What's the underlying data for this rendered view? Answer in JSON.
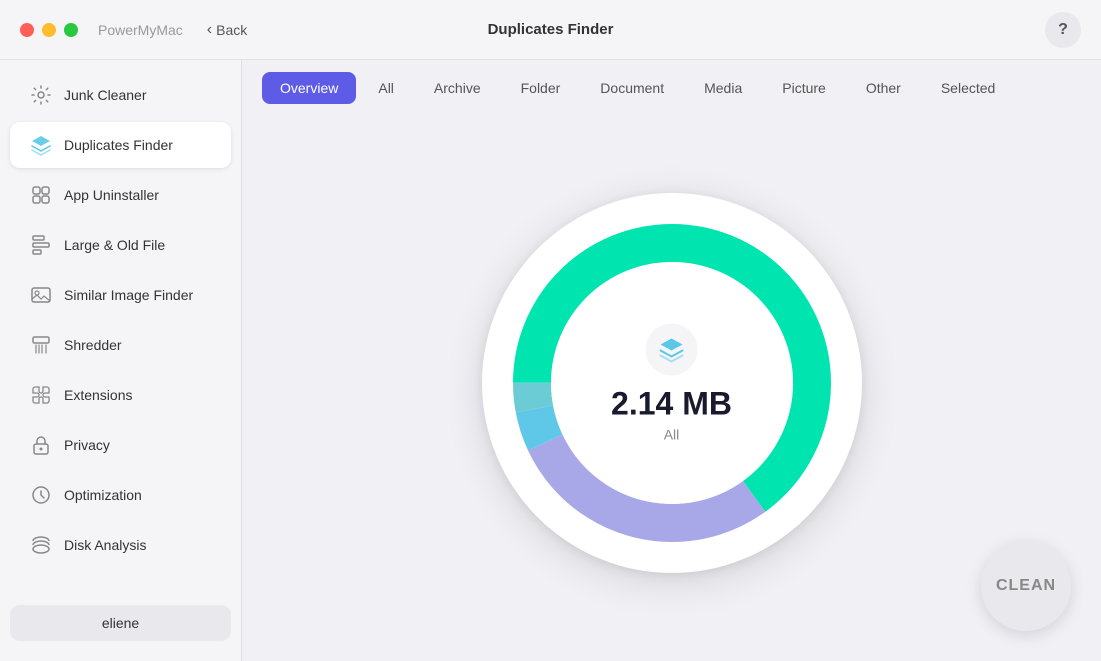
{
  "titlebar": {
    "app_name": "PowerMyMac",
    "back_label": "Back",
    "title": "Duplicates Finder",
    "help_label": "?"
  },
  "sidebar": {
    "items": [
      {
        "id": "junk-cleaner",
        "label": "Junk Cleaner",
        "icon": "gear"
      },
      {
        "id": "duplicates-finder",
        "label": "Duplicates Finder",
        "icon": "layers",
        "active": true
      },
      {
        "id": "app-uninstaller",
        "label": "App Uninstaller",
        "icon": "app"
      },
      {
        "id": "large-old-file",
        "label": "Large & Old File",
        "icon": "file"
      },
      {
        "id": "similar-image",
        "label": "Similar Image Finder",
        "icon": "image"
      },
      {
        "id": "shredder",
        "label": "Shredder",
        "icon": "shredder"
      },
      {
        "id": "extensions",
        "label": "Extensions",
        "icon": "extensions"
      },
      {
        "id": "privacy",
        "label": "Privacy",
        "icon": "lock"
      },
      {
        "id": "optimization",
        "label": "Optimization",
        "icon": "optimization"
      },
      {
        "id": "disk-analysis",
        "label": "Disk Analysis",
        "icon": "disk"
      }
    ],
    "user_label": "eliene"
  },
  "tabs": [
    {
      "id": "overview",
      "label": "Overview",
      "active": true
    },
    {
      "id": "all",
      "label": "All",
      "active": false
    },
    {
      "id": "archive",
      "label": "Archive",
      "active": false
    },
    {
      "id": "folder",
      "label": "Folder",
      "active": false
    },
    {
      "id": "document",
      "label": "Document",
      "active": false
    },
    {
      "id": "media",
      "label": "Media",
      "active": false
    },
    {
      "id": "picture",
      "label": "Picture",
      "active": false
    },
    {
      "id": "other",
      "label": "Other",
      "active": false
    },
    {
      "id": "selected",
      "label": "Selected",
      "active": false
    }
  ],
  "chart": {
    "size": "2.14 MB",
    "label": "All",
    "segments": [
      {
        "color": "#00e5b0",
        "value": 65
      },
      {
        "color": "#a8a8e8",
        "value": 28
      },
      {
        "color": "#5fc8e8",
        "value": 4
      },
      {
        "color": "#6bccd6",
        "value": 3
      }
    ]
  },
  "clean_button": {
    "label": "CLEAN"
  }
}
